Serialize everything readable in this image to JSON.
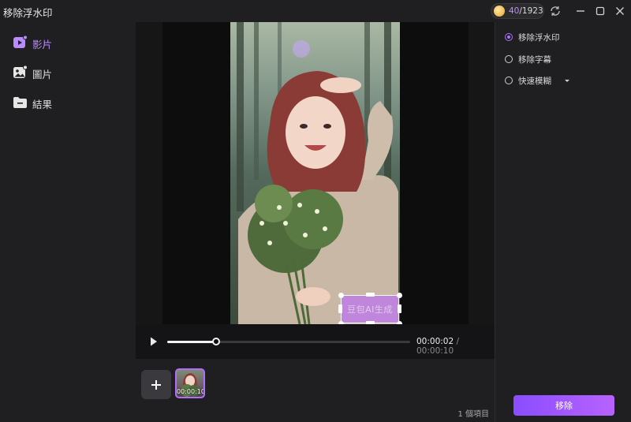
{
  "window": {
    "title": "移除浮水印"
  },
  "credits": {
    "used": "40",
    "total": "/1923"
  },
  "sidebar": {
    "items": [
      {
        "label": "影片",
        "icon": "video-icon",
        "active": true
      },
      {
        "label": "圖片",
        "icon": "image-icon",
        "active": false
      },
      {
        "label": "結果",
        "icon": "folder-icon",
        "active": false
      }
    ]
  },
  "preview": {
    "watermark_text": "豆包AI生成",
    "selection_label": "watermark-selection"
  },
  "player": {
    "current_time": "00:00:02",
    "separator": " / ",
    "duration": "00:00:10",
    "progress": 0.2
  },
  "media_strip": {
    "thumbnail_time": "00:00:10",
    "item_count": "1 個項目"
  },
  "options": {
    "items": [
      {
        "label": "移除浮水印",
        "checked": true
      },
      {
        "label": "移除字幕",
        "checked": false
      },
      {
        "label": "快速模糊",
        "checked": false,
        "has_dropdown": true
      }
    ]
  },
  "actions": {
    "remove_label": "移除"
  },
  "colors": {
    "accent": "#a872ff",
    "background": "#1f1f21",
    "button_gradient_start": "#8a4dff",
    "button_gradient_end": "#b862ff"
  }
}
